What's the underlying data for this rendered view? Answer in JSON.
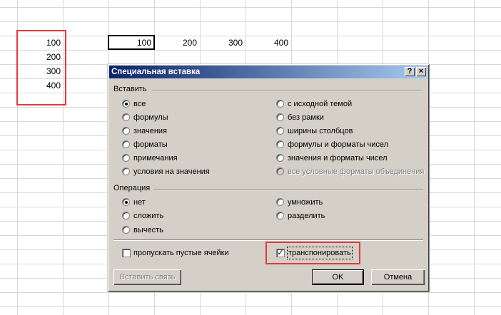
{
  "sheet": {
    "column_values": [
      "100",
      "200",
      "300",
      "400"
    ],
    "row_values": [
      "100",
      "200",
      "300",
      "400"
    ]
  },
  "dialog": {
    "title": "Специальная вставка",
    "help_button": "?",
    "close_button": "×",
    "paste_group_label": "Вставить",
    "paste_options_left": [
      "все",
      "формулы",
      "значения",
      "форматы",
      "примечания",
      "условия на значения"
    ],
    "paste_options_right": [
      "с исходной темой",
      "без рамки",
      "ширины столбцов",
      "формулы и форматы чисел",
      "значения и форматы чисел",
      "все условные форматы объединения"
    ],
    "paste_selected": "все",
    "operation_group_label": "Операция",
    "operation_options_left": [
      "нет",
      "сложить",
      "вычесть"
    ],
    "operation_options_right": [
      "умножить",
      "разделить"
    ],
    "operation_selected": "нет",
    "skip_blanks_label": "пропускать пустые ячейки",
    "skip_blanks_checked": false,
    "transpose_label": "транспонировать",
    "transpose_checked": true,
    "paste_link_button": "Вставить связь",
    "ok_button": "OK",
    "cancel_button": "Отмена"
  },
  "colors": {
    "highlight": "#e23a3a",
    "dialog_bg": "#d4d0c8",
    "title_start": "#0a246a",
    "title_end": "#a6caf0"
  }
}
